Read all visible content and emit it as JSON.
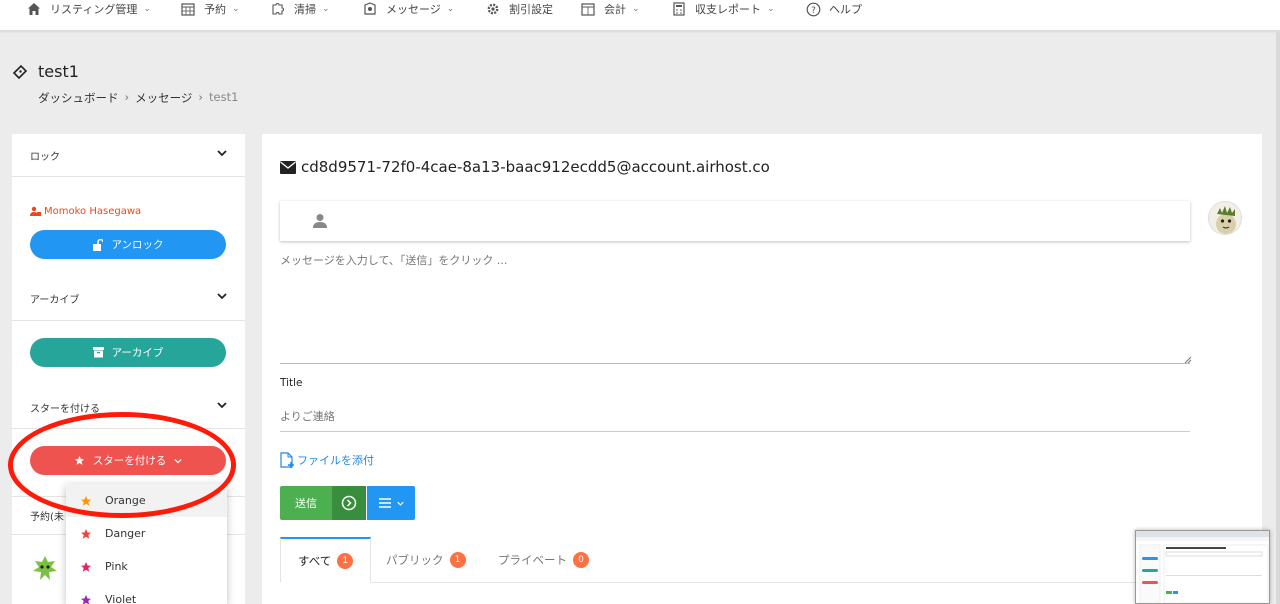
{
  "nav": {
    "items": [
      {
        "label": "リスティング管理",
        "icon": "home-icon",
        "dropdown": true
      },
      {
        "label": "予約",
        "icon": "calendar-icon",
        "dropdown": true
      },
      {
        "label": "清掃",
        "icon": "puzzle-icon",
        "dropdown": true
      },
      {
        "label": "メッセージ",
        "icon": "message-icon",
        "dropdown": true
      },
      {
        "label": "割引設定",
        "icon": "gear-icon",
        "dropdown": false
      },
      {
        "label": "会計",
        "icon": "ledger-icon",
        "dropdown": true
      },
      {
        "label": "収支レポート",
        "icon": "calculator-icon",
        "dropdown": true
      },
      {
        "label": "ヘルプ",
        "icon": "help-icon",
        "dropdown": false
      }
    ]
  },
  "header": {
    "title": "test1",
    "breadcrumb": [
      "ダッシュボード",
      "メッセージ",
      "test1"
    ]
  },
  "sidebar": {
    "lock_section": "ロック",
    "user_name": "Momoko Hasegawa",
    "unlock_button": "アンロック",
    "archive_section": "アーカイブ",
    "archive_button": "アーカイブ",
    "star_section": "スターを付ける",
    "star_button": "スターを付ける",
    "reservation_label": "予約(未",
    "star_options": [
      {
        "label": "Orange",
        "color": "#ff9800"
      },
      {
        "label": "Danger",
        "color": "#f44336"
      },
      {
        "label": "Pink",
        "color": "#e91e63"
      },
      {
        "label": "Violet",
        "color": "#9c27b0"
      }
    ]
  },
  "main": {
    "email": "cd8d9571-72f0-4cae-8a13-baac912ecdd5@account.airhost.co",
    "message_placeholder": "メッセージを入力して、「送信」をクリック ...",
    "title_label": "Title",
    "title_placeholder": "よりご連絡",
    "attach_label": "ファイルを添付",
    "send_label": "送信",
    "tabs": [
      {
        "label": "すべて",
        "count": "1"
      },
      {
        "label": "パブリック",
        "count": "1"
      },
      {
        "label": "プライベート",
        "count": "0"
      }
    ]
  },
  "colors": {
    "primary": "#2196f3",
    "teal": "#26a69a",
    "danger": "#ef5350",
    "success": "#4caf50",
    "badge": "#ff7043",
    "annotation": "#ff1a0a"
  }
}
